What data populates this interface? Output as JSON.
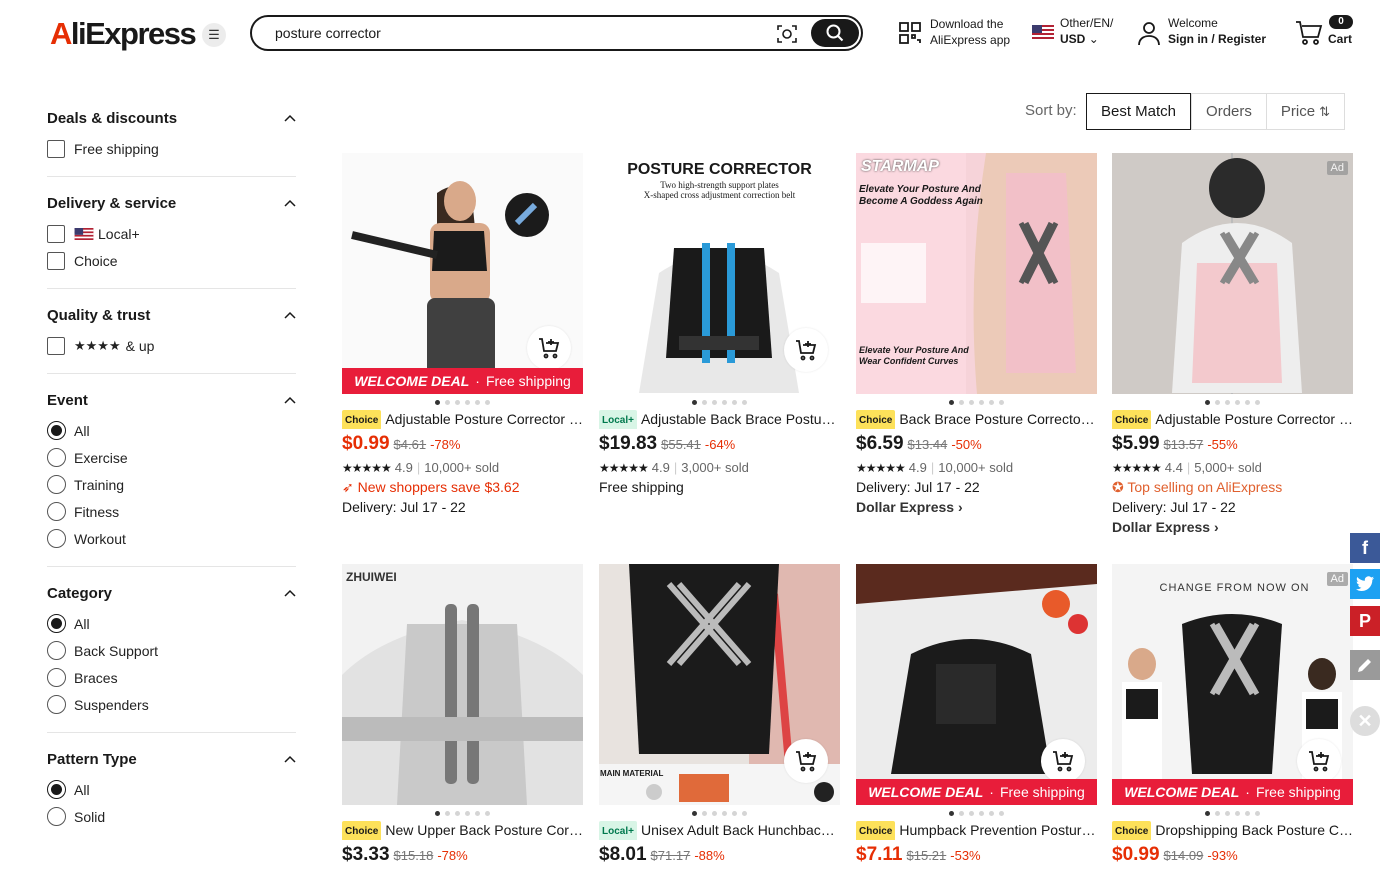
{
  "header": {
    "logo_a": "A",
    "logo_rest": "liExpress",
    "search_value": "posture corrector",
    "app_line1": "Download the",
    "app_line2": "AliExpress app",
    "locale_line1": "Other/EN/",
    "locale_line2": "USD",
    "account_line1": "Welcome",
    "account_line2": "Sign in / Register",
    "cart_label": "Cart",
    "cart_count": "0"
  },
  "sidebar": {
    "deals": {
      "title": "Deals & discounts",
      "options": [
        "Free shipping"
      ]
    },
    "delivery": {
      "title": "Delivery & service",
      "options": [
        "Local+",
        "Choice"
      ]
    },
    "quality": {
      "title": "Quality & trust",
      "stars": "★★★★",
      "option": "& up"
    },
    "event": {
      "title": "Event",
      "options": [
        "All",
        "Exercise",
        "Training",
        "Fitness",
        "Workout"
      ]
    },
    "category": {
      "title": "Category",
      "options": [
        "All",
        "Back Support",
        "Braces",
        "Suspenders"
      ]
    },
    "pattern": {
      "title": "Pattern Type",
      "options": [
        "All",
        "Solid"
      ]
    }
  },
  "sort": {
    "label": "Sort by:",
    "options": [
      "Best Match",
      "Orders",
      "Price"
    ],
    "active": "Best Match"
  },
  "products": [
    {
      "badge": "Choice",
      "title": "Adjustable Posture Corrector Back Support",
      "price": "$0.99",
      "orig": "$4.61",
      "disc": "-78%",
      "stars": "★★★★★",
      "rating": "4.9",
      "sold": "10,000+ sold",
      "line1": "New shoppers save $3.62",
      "line2": "Delivery: Jul 17 - 22",
      "deal_left": "WELCOME DEAL",
      "deal_right": "Free shipping"
    },
    {
      "badge": "Local+",
      "title": "Adjustable Back Brace Posture Corrector",
      "price": "$19.83",
      "orig": "$55.41",
      "disc": "-64%",
      "stars": "★★★★★",
      "rating": "4.9",
      "sold": "3,000+ sold",
      "line1": "Free shipping",
      "img_title": "POSTURE CORRECTOR",
      "img_sub1": "Two high-strength support plates",
      "img_sub2": "X-shaped cross adjustment correction belt"
    },
    {
      "badge": "Choice",
      "title": "Back Brace Posture Corrector for Women",
      "price": "$6.59",
      "orig": "$13.44",
      "disc": "-50%",
      "stars": "★★★★★",
      "rating": "4.9",
      "sold": "10,000+ sold",
      "line1": "Delivery: Jul 17 - 22",
      "line2": "Dollar Express ›",
      "img_brand": "STARMAP",
      "img_h1": "Elevate Your Posture And Become A Goddess Again",
      "img_h2": "Elevate Your Posture And Wear Confident Curves"
    },
    {
      "badge": "Choice",
      "title": "Adjustable Posture Corrector Women Back",
      "price": "$5.99",
      "orig": "$13.57",
      "disc": "-55%",
      "stars": "★★★★★",
      "rating": "4.4",
      "sold": "5,000+ sold",
      "line1": "Top selling on AliExpress",
      "line2": "Delivery: Jul 17 - 22",
      "line3": "Dollar Express ›",
      "ad": "Ad"
    },
    {
      "badge": "Choice",
      "title": "New Upper Back Posture Corrector Brace",
      "price": "$3.33",
      "orig": "$15.18",
      "disc": "-78%",
      "img_brand": "ZHUIWEI"
    },
    {
      "badge": "Local+",
      "title": "Unisex Adult Back Hunchback Corrector",
      "price": "$8.01",
      "orig": "$71.17",
      "disc": "-88%",
      "img_tag": "MAIN MATERIAL"
    },
    {
      "badge": "Choice",
      "title": "Humpback Prevention Posture Corrector",
      "price": "$7.11",
      "orig": "$15.21",
      "disc": "-53%",
      "deal_left": "WELCOME DEAL",
      "deal_right": "Free shipping"
    },
    {
      "badge": "Choice",
      "title": "Dropshipping Back Posture Corrector",
      "price": "$0.99",
      "orig": "$14.09",
      "disc": "-93%",
      "deal_left": "WELCOME DEAL",
      "deal_right": "Free shipping",
      "ad": "Ad",
      "img_top": "CHANGE FROM NOW ON"
    }
  ],
  "colors": {
    "brand": "#e62e04",
    "deal": "#e81d3a",
    "choice": "#fde15a",
    "facebook": "#3b5998",
    "twitter": "#1da1f2",
    "pinterest": "#cb2027"
  },
  "share": [
    "facebook-icon",
    "twitter-icon",
    "pinterest-icon",
    "edit-icon",
    "close-icon"
  ]
}
